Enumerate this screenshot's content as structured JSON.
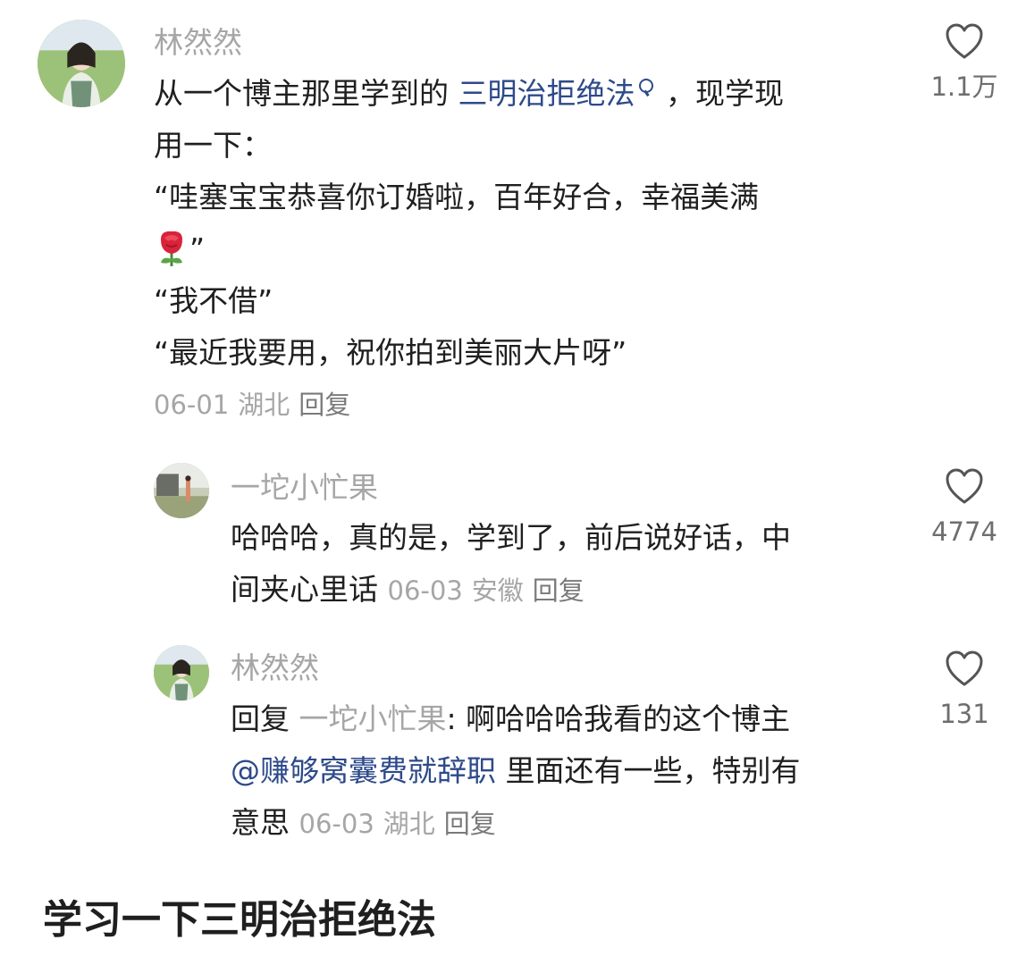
{
  "comments": [
    {
      "username": "林然然",
      "text_pre": "从一个博主那里学到的 ",
      "keyword": "三明治拒绝法",
      "text_post": " ，现学现",
      "lines": [
        "用一下：",
        "“哇塞宝宝恭喜你订婚啦，百年好合，幸福美满",
        "”",
        "“我不借”",
        "“最近我要用，祝你拍到美丽大片呀”"
      ],
      "date": "06-01",
      "location": "湖北",
      "reply_label": "回复",
      "likes": "1.1万"
    },
    {
      "username": "一坨小忙果",
      "lines": [
        "哈哈哈，真的是，学到了，前后说好话，中",
        "间夹心里话"
      ],
      "date": "06-03",
      "location": "安徽",
      "reply_label": "回复",
      "likes": "4774"
    },
    {
      "username": "林然然",
      "reply_prefix": "回复",
      "reply_target": "一坨小忙果",
      "text_line1": ": 啊哈哈哈我看的这个博主",
      "mention": "@赚够窝囊费就辞职",
      "text_line2": " 里面还有一些，特别有",
      "text_line3": "意思",
      "date": "06-03",
      "location": "湖北",
      "reply_label": "回复",
      "likes": "131"
    }
  ],
  "footer": {
    "title": "学习一下三明治拒绝法"
  },
  "icons": {
    "like": "heart-outline-icon",
    "keyword_search": "search-icon",
    "emoji": "rose-icon"
  },
  "colors": {
    "username": "#a6a6a6",
    "link": "#2d4a8a",
    "text": "#1f1f1f",
    "meta": "#a6a6a6"
  }
}
